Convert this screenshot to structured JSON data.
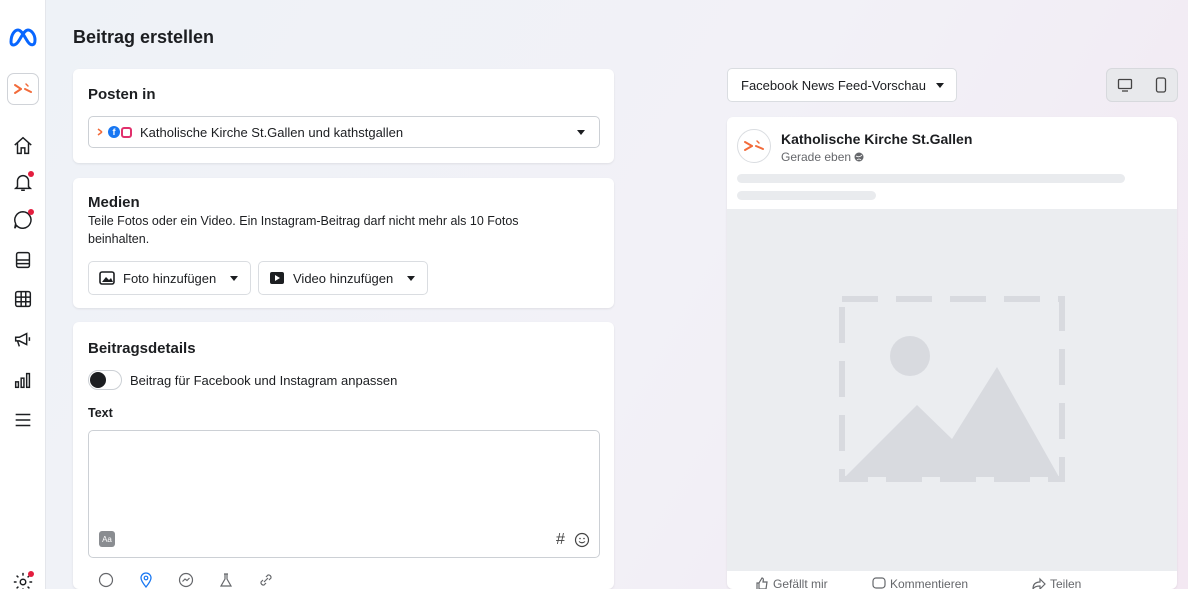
{
  "page": {
    "title": "Beitrag erstellen"
  },
  "posten_in": {
    "title": "Posten in",
    "selected": "Katholische Kirche St.Gallen und kathstgallen"
  },
  "medien": {
    "title": "Medien",
    "description": "Teile Fotos oder ein Video. Ein Instagram-Beitrag darf nicht mehr als 10 Fotos beinhalten.",
    "photo_button": "Foto hinzufügen",
    "video_button": "Video hinzufügen"
  },
  "details": {
    "title": "Beitragsdetails",
    "toggle_label": "Beitrag für Facebook und Instagram anpassen",
    "text_label": "Text",
    "text_value": "",
    "hashtag_symbol": "#"
  },
  "preview": {
    "selector": "Facebook News Feed-Vorschau",
    "page_name": "Katholische Kirche St.Gallen",
    "timestamp": "Gerade eben",
    "actions": [
      "Gefällt mir",
      "Kommentieren",
      "Teilen"
    ]
  },
  "colors": {
    "accent": "#1877f2",
    "notification": "#e41e3f",
    "brand_orange": "#f26b3a"
  }
}
